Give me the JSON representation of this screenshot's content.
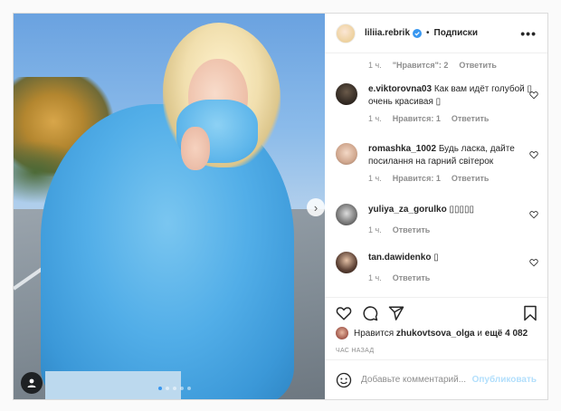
{
  "header": {
    "username": "liliia.rebrik",
    "separator": "•",
    "follow_label": "Подписки",
    "more": "•••"
  },
  "comments": {
    "previous_meta": {
      "time": "1 ч.",
      "likes": "\"Нравится\": 2",
      "reply": "Ответить"
    },
    "items": [
      {
        "username": "e.viktorovna03",
        "text": "Как вам идёт голубой ▯ очень красивая ▯",
        "time": "1 ч.",
        "likes": "Нравится: 1",
        "reply": "Ответить"
      },
      {
        "username": "romashka_1002",
        "text": "Будь ласка, дайте посилання на гарний світерок",
        "time": "1 ч.",
        "likes": "Нравится: 1",
        "reply": "Ответить"
      },
      {
        "username": "yuliya_za_gorulko",
        "text": "▯▯▯▯▯",
        "time": "1 ч.",
        "likes": "",
        "reply": "Ответить"
      },
      {
        "username": "tan.dawidenko",
        "text": "▯",
        "time": "1 ч.",
        "likes": "",
        "reply": "Ответить"
      }
    ]
  },
  "likes": {
    "prefix": "Нравится",
    "user": "zhukovtsova_olga",
    "conj": "и",
    "rest": "ещё 4 082"
  },
  "time_ago": "ЧАС НАЗАД",
  "add_comment": {
    "placeholder": "Добавьте комментарий...",
    "publish_label": "Опубликовать"
  },
  "colors": {
    "link_blue": "#3897f0",
    "publish_disabled": "#b2dffc",
    "muted": "#8e8e8e"
  },
  "icons": {
    "verified": "verified-badge-icon",
    "like": "heart-icon",
    "comment": "comment-icon",
    "share": "share-icon",
    "save": "bookmark-icon",
    "emoji": "emoji-icon",
    "next": "chevron-right-icon",
    "tag": "user-tag-icon"
  },
  "carousel": {
    "slides": 5,
    "active": 1
  }
}
